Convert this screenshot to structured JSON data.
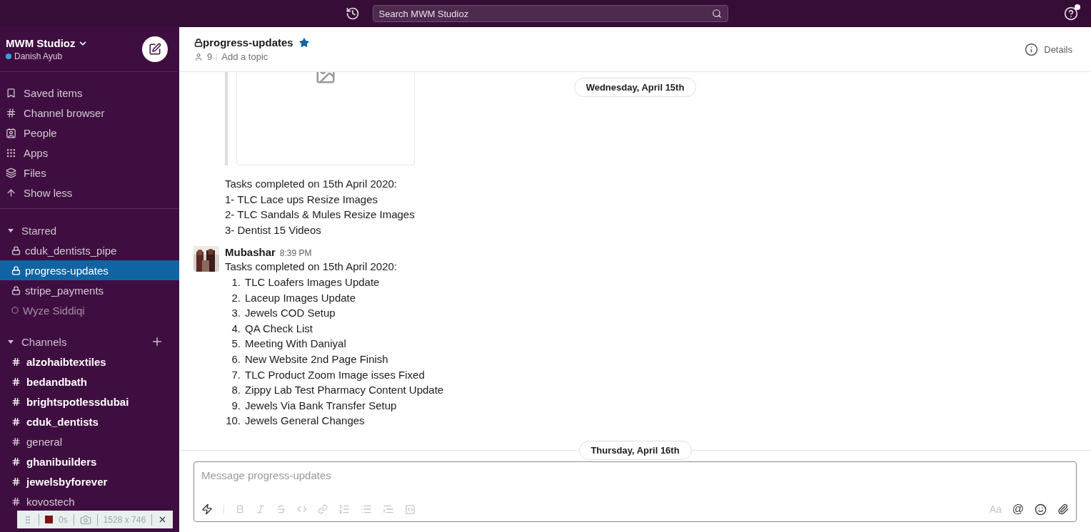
{
  "top_bar": {
    "search_placeholder": "Search MWM Studioz",
    "help_badge": true
  },
  "workspace": {
    "name": "MWM Studioz",
    "user": "Danish Ayub"
  },
  "nav_items": [
    {
      "kind": "saved",
      "label": "Saved items"
    },
    {
      "kind": "browser",
      "label": "Channel browser"
    },
    {
      "kind": "people",
      "label": "People"
    },
    {
      "kind": "apps",
      "label": "Apps"
    },
    {
      "kind": "files",
      "label": "Files"
    },
    {
      "kind": "less",
      "label": "Show less"
    }
  ],
  "starred": {
    "title": "Starred",
    "expanded": true,
    "items": [
      {
        "kind": "private",
        "label": "cduk_dentists_pipe",
        "selected": false,
        "unread": false
      },
      {
        "kind": "private",
        "label": "progress-updates",
        "selected": true,
        "unread": false
      },
      {
        "kind": "private",
        "label": "stripe_payments",
        "selected": false,
        "unread": false
      },
      {
        "kind": "dm",
        "label": "Wyze Siddiqi",
        "selected": false,
        "unread": false
      }
    ]
  },
  "channels": {
    "title": "Channels",
    "expanded": true,
    "items": [
      {
        "label": "alzohaibtextiles",
        "selected": false,
        "unread": true
      },
      {
        "label": "bedandbath",
        "selected": false,
        "unread": true
      },
      {
        "label": "brightspotlessdubai",
        "selected": false,
        "unread": true
      },
      {
        "label": "cduk_dentists",
        "selected": false,
        "unread": true
      },
      {
        "label": "general",
        "selected": false,
        "unread": false
      },
      {
        "label": "ghanibuilders",
        "selected": false,
        "unread": true
      },
      {
        "label": "jewelsbyforever",
        "selected": false,
        "unread": true
      },
      {
        "label": "kovostech",
        "selected": false,
        "unread": false
      }
    ]
  },
  "channel_header": {
    "name": "progress-updates",
    "starred": true,
    "members": "9",
    "topic_placeholder": "Add a topic",
    "details": "Details"
  },
  "messages": [
    {
      "kind": "continuation",
      "lines": [
        "Tasks completed on 15th April 2020:",
        "1- TLC Lace ups Resize Images",
        "2- TLC Sandals & Mules Resize Images",
        "3- Dentist 15 Videos"
      ]
    },
    {
      "kind": "message",
      "author": "Mubashar",
      "time": "8:39 PM",
      "intro": "Tasks completed on 15th April 2020:",
      "list": [
        {
          "number": "1.",
          "text": "TLC Loafers Images Update"
        },
        {
          "number": "2.",
          "text": "Laceup Images Update"
        },
        {
          "number": "3.",
          "text": "Jewels COD Setup"
        },
        {
          "number": "4.",
          "text": "QA Check List"
        },
        {
          "number": "5.",
          "text": "Meeting With Daniyal"
        },
        {
          "number": "6.",
          "text": "New Website 2nd Page Finish"
        },
        {
          "number": "7.",
          "text": "TLC Product Zoom Image isses Fixed"
        },
        {
          "number": "8.",
          "text": "Zippy Lab Test Pharmacy Content Update"
        },
        {
          "number": "9.",
          "text": "Jewels Via Bank Transfer Setup"
        },
        {
          "number": "10.",
          "text": "Jewels General Changes"
        }
      ]
    }
  ],
  "date_dividers": [
    "Wednesday, April 15th",
    "Thursday, April 16th"
  ],
  "composer": {
    "placeholder": "Message progress-updates",
    "format_label": "Aa",
    "mention": "@"
  },
  "recorder": {
    "time": "0s",
    "size": "1528 x 746"
  }
}
